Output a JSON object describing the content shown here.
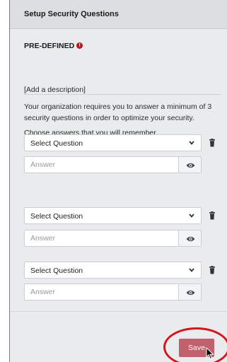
{
  "header": {
    "title": "Setup Security Questions"
  },
  "section": {
    "label": "PRE-DEFINED",
    "alert_icon": "!"
  },
  "description": "[Add a description]",
  "intro": "Your organization requires you to answer a minimum of 3 security questions in order to optimize your security.",
  "instruction": "Choose answers that you will remember.",
  "questions": [
    {
      "select_label": "Select Question",
      "answer_placeholder": "Answer"
    },
    {
      "select_label": "Select Question",
      "answer_placeholder": "Answer"
    },
    {
      "select_label": "Select Question",
      "answer_placeholder": "Answer"
    }
  ],
  "save_label": "Save",
  "colors": {
    "save": "#c0616b",
    "alert": "#c0111f",
    "highlight": "#d2161d",
    "panel": "#e9ebec"
  },
  "icons": {
    "dropdown": "chevron-down-icon",
    "delete": "trash-icon",
    "reveal": "eye-icon",
    "pointer": "mouse-cursor-icon"
  }
}
